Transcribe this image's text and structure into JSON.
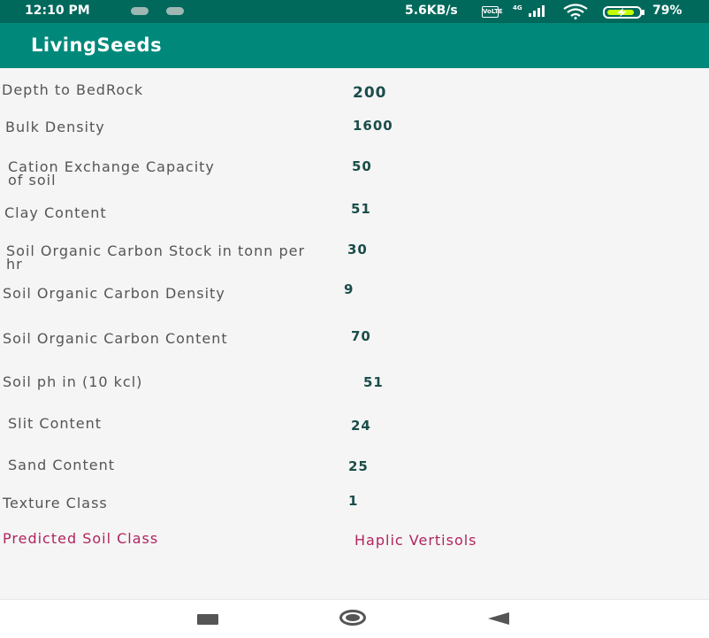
{
  "status_bar": {
    "time": "12:10 PM",
    "network_speed": "5.6KB/s",
    "volte_badge": "VoLTE",
    "signal_label": "4G",
    "battery_percent": "79%"
  },
  "app_bar": {
    "title": "LivingSeeds"
  },
  "fields": [
    {
      "label": "Depth to BedRock",
      "value": "200"
    },
    {
      "label": "Bulk Density",
      "value": "1600"
    },
    {
      "label": "Cation Exchange Capacity of soil",
      "value": "50"
    },
    {
      "label": "Clay Content",
      "value": "51"
    },
    {
      "label": "Soil Organic Carbon Stock in tonn per hr",
      "value": "30"
    },
    {
      "label": "Soil Organic Carbon Density",
      "value": "9"
    },
    {
      "label": "Soil Organic Carbon Content",
      "value": "70"
    },
    {
      "label": "Soil ph in (10 kcl)",
      "value": "51"
    },
    {
      "label": "Slit Content",
      "value": "24"
    },
    {
      "label": "Sand Content",
      "value": "25"
    },
    {
      "label": "Texture Class",
      "value": "1"
    }
  ],
  "prediction": {
    "label": "Predicted Soil Class",
    "value": "Haplic Vertisols"
  },
  "colors": {
    "status_bar": "#00695c",
    "app_bar": "#00897b",
    "prediction_text": "#b0245f",
    "value_text": "#1b4d4a"
  }
}
